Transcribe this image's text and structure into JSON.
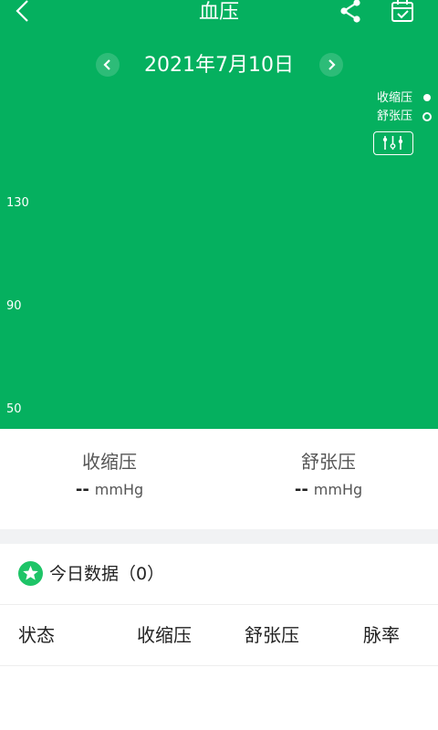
{
  "header": {
    "title": "血压"
  },
  "date": {
    "text": "2021年7月10日"
  },
  "legend": [
    {
      "label": "收缩压",
      "style": "filled"
    },
    {
      "label": "舒张压",
      "style": "hollow"
    }
  ],
  "chart_data": {
    "type": "line",
    "title": "",
    "xlabel": "",
    "ylabel": "",
    "y_ticks": [
      "130",
      "90",
      "50"
    ],
    "series": [
      {
        "name": "收缩压",
        "values": []
      },
      {
        "name": "舒张压",
        "values": []
      }
    ],
    "legend_placement": "top-right"
  },
  "stats": {
    "systolic": {
      "label": "收缩压",
      "value": "--",
      "unit": "mmHg"
    },
    "diastolic": {
      "label": "舒张压",
      "value": "--",
      "unit": "mmHg"
    }
  },
  "today": {
    "label": "今日数据（0）"
  },
  "table": {
    "columns": [
      "状态",
      "收缩压",
      "舒张压",
      "脉率"
    ]
  },
  "colors": {
    "accent": "#05b05f",
    "star": "#1ec467",
    "divider": "#f1f2f4"
  },
  "icons": [
    "chevron-left-icon",
    "share-icon",
    "calendar-check-icon",
    "chevron-left-icon",
    "chevron-right-icon",
    "adjust-sliders-icon",
    "star-icon"
  ]
}
